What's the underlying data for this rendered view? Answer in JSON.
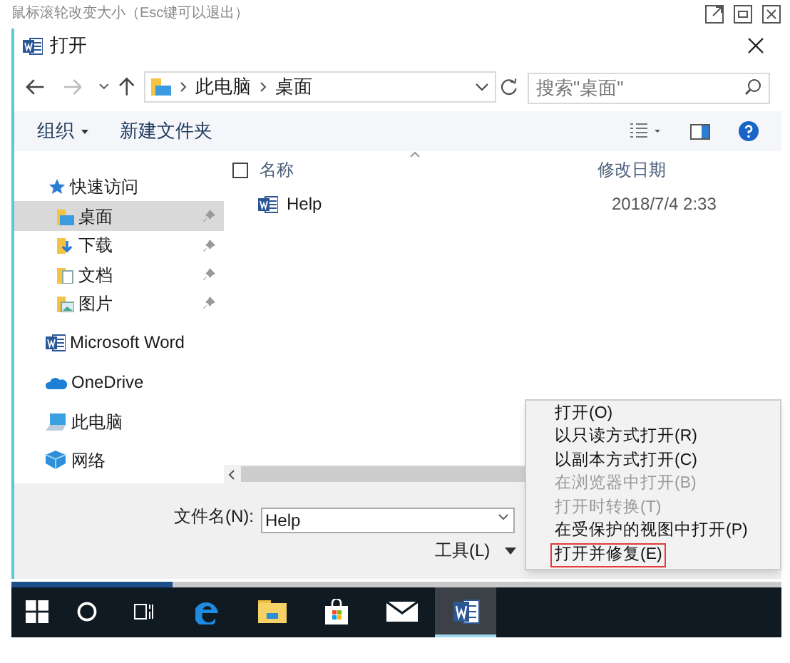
{
  "viewer": {
    "hint": "鼠标滚轮改变大小（Esc键可以退出）"
  },
  "dialog": {
    "title": "打开",
    "nav": {
      "path": [
        "此电脑",
        "桌面"
      ],
      "search_placeholder": "搜索\"桌面\""
    },
    "toolbar": {
      "organize": "组织",
      "new_folder": "新建文件夹"
    },
    "sidebar": [
      {
        "label": "快速访问",
        "kind": "star",
        "selected": false,
        "pinned": false
      },
      {
        "label": "桌面",
        "kind": "desktop",
        "selected": true,
        "pinned": true
      },
      {
        "label": "下载",
        "kind": "download",
        "selected": false,
        "pinned": true
      },
      {
        "label": "文档",
        "kind": "documents",
        "selected": false,
        "pinned": true
      },
      {
        "label": "图片",
        "kind": "pictures",
        "selected": false,
        "pinned": true
      },
      {
        "label": "Microsoft Word",
        "kind": "word",
        "selected": false,
        "pinned": false
      },
      {
        "label": "OneDrive",
        "kind": "cloud",
        "selected": false,
        "pinned": false
      },
      {
        "label": "此电脑",
        "kind": "pc",
        "selected": false,
        "pinned": false
      },
      {
        "label": "网络",
        "kind": "network",
        "selected": false,
        "pinned": false
      }
    ],
    "select_all": {
      "checked": false
    },
    "columns": [
      "名称",
      "修改日期"
    ],
    "files": [
      {
        "name": "Help",
        "modified": "2018/7/4 2:33"
      }
    ],
    "file_name": {
      "label": "文件名(N):",
      "value": "Help"
    },
    "tools": "工具(L)",
    "open_menu": [
      {
        "label": "打开(O)",
        "disabled": false,
        "selected": false
      },
      {
        "label": "以只读方式打开(R)",
        "disabled": false,
        "selected": false
      },
      {
        "label": "以副本方式打开(C)",
        "disabled": false,
        "selected": false
      },
      {
        "label": "在浏览器中打开(B)",
        "disabled": true,
        "selected": false
      },
      {
        "label": "打开时转换(T)",
        "disabled": true,
        "selected": false
      },
      {
        "label": "在受保护的视图中打开(P)",
        "disabled": false,
        "selected": false
      },
      {
        "label": "打开并修复(E)",
        "disabled": false,
        "selected": true
      }
    ]
  },
  "progress": {
    "level": 0.21
  },
  "taskbar": [
    {
      "kind": "start",
      "selected": false
    },
    {
      "kind": "search",
      "selected": false
    },
    {
      "kind": "task_view",
      "selected": false
    },
    {
      "kind": "edge",
      "selected": false
    },
    {
      "kind": "explorer",
      "selected": false
    },
    {
      "kind": "store",
      "selected": false
    },
    {
      "kind": "mail",
      "selected": false
    },
    {
      "kind": "word",
      "selected": true
    }
  ]
}
